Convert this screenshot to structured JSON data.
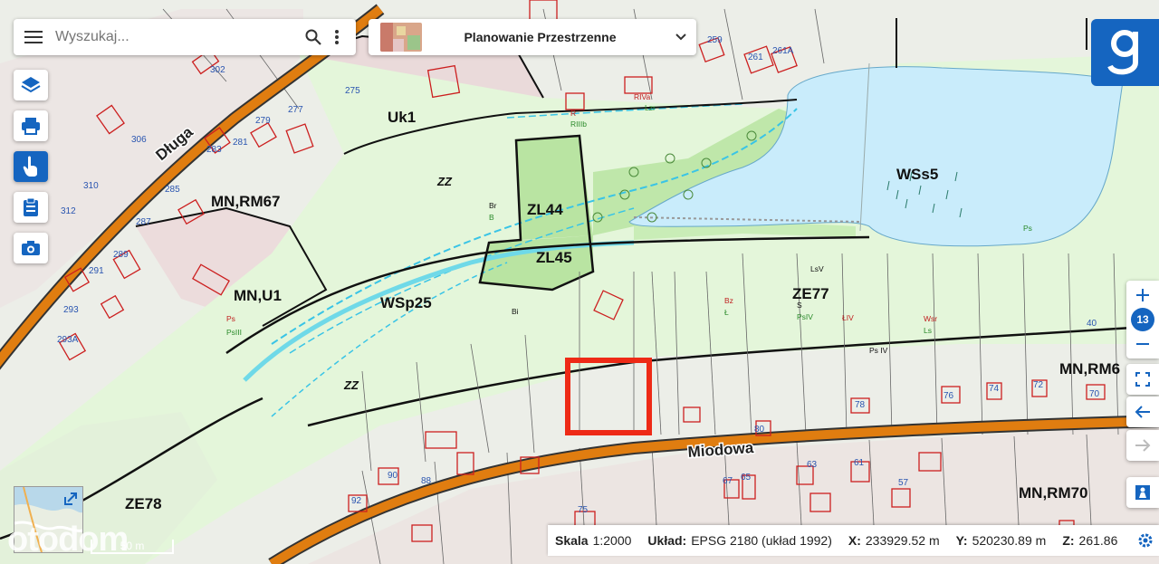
{
  "search": {
    "placeholder": "Wyszukaj..."
  },
  "layer_selector": {
    "title": "Planowanie Przestrzenne"
  },
  "map": {
    "street_labels": [
      "Długa",
      "Miodowa"
    ],
    "zone_labels": [
      "Uk1",
      "ZL44",
      "ZL45",
      "MN,RM67",
      "WSs5",
      "MN,U1",
      "WSp25",
      "ZE77",
      "MN,RM6",
      "ZE78",
      "MN,RM70",
      "ZZ",
      "ZZ"
    ],
    "parcel_numbers": [
      "302",
      "306",
      "310",
      "312",
      "293",
      "293A",
      "291",
      "289",
      "287",
      "285",
      "283",
      "281",
      "279",
      "277",
      "275",
      "259",
      "261",
      "261A",
      "40",
      "78",
      "76",
      "74",
      "72",
      "70",
      "80",
      "88",
      "90",
      "92",
      "75",
      "67",
      "65",
      "63",
      "61",
      "57"
    ],
    "small_labels": [
      "Ps",
      "PsIII",
      "R",
      "RIIIb",
      "RIVa",
      "Lzr",
      "Br",
      "B",
      "Bi",
      "Bz",
      "Ł",
      "ŁIV",
      "Wsr",
      "Ls",
      "LsV",
      "S",
      "PsIV",
      "Ps IV"
    ]
  },
  "zoom": {
    "level": "13"
  },
  "status": {
    "scale_label": "Skala",
    "scale_value": "1:2000",
    "crs_label": "Układ:",
    "crs_value": "EPSG 2180 (układ 1992)",
    "x_label": "X:",
    "x_value": "233929.52 m",
    "y_label": "Y:",
    "y_value": "520230.89 m",
    "z_label": "Z:",
    "z_value": "261.86"
  },
  "scale_bar": {
    "label": "50 m"
  },
  "watermark": "otodom",
  "colors": {
    "accent": "#1565c0",
    "road": "#e07d10",
    "water": "#c9ecfb",
    "meadow": "#e2f7d8",
    "forest": "#b8e5a3",
    "residential": "#e9dfe0",
    "selection": "#ee2a16",
    "parcel_outline": "#cc1f1f"
  }
}
